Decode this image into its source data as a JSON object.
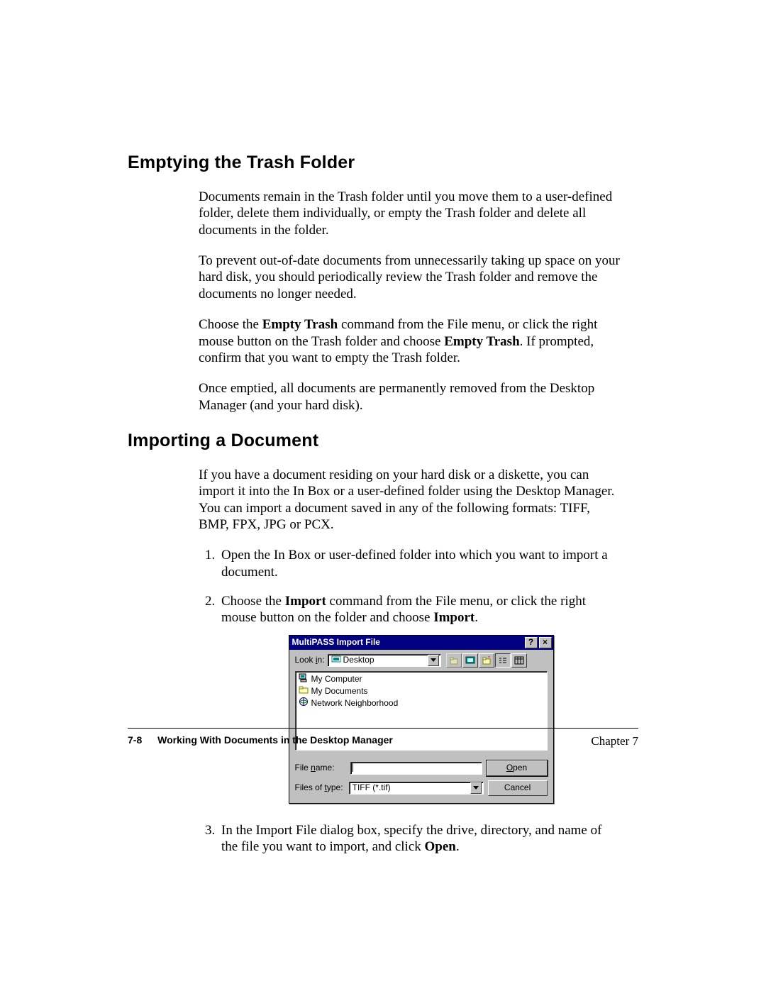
{
  "headings": {
    "h1": "Emptying the Trash Folder",
    "h2": "Importing a Document"
  },
  "paras": {
    "p1": "Documents remain in the Trash folder until you move them to a user-defined folder, delete them individually, or empty the Trash folder and delete all documents in the folder.",
    "p2": "To prevent out-of-date documents from unnecessarily taking up space on your hard disk, you should periodically review the Trash folder and remove the documents no longer needed.",
    "p3a": "Choose the ",
    "p3b": "Empty Trash",
    "p3c": " command from the File menu, or click the right mouse button on the Trash folder and choose ",
    "p3d": "Empty Trash",
    "p3e": ". If prompted, confirm that you want to empty the Trash folder.",
    "p4": "Once emptied, all documents are permanently removed from the Desktop Manager (and your hard disk).",
    "p5": "If you have a document residing on your hard disk or a diskette, you can import it into the In Box or a user-defined folder using the Desktop Manager. You can import a document saved in any of the following formats: TIFF, BMP, FPX, JPG or PCX."
  },
  "steps": {
    "s1": "Open the In Box or user-defined folder into which you want to import a document.",
    "s2a": "Choose the ",
    "s2b": "Import",
    "s2c": " command from the File menu, or click the right mouse button on the folder and choose ",
    "s2d": "Import",
    "s2e": ".",
    "s3a": "In the Import File dialog box, specify the drive, directory, and name of the file you want to import, and click ",
    "s3b": "Open",
    "s3c": "."
  },
  "dialog": {
    "title": "MultiPASS Import File",
    "help_btn": "?",
    "close_btn": "×",
    "lookin_label_pre": "Look ",
    "lookin_label_u": "i",
    "lookin_label_post": "n:",
    "lookin_value": "Desktop",
    "items": {
      "i1": "My Computer",
      "i2": "My Documents",
      "i3": "Network Neighborhood"
    },
    "filename_label_pre": "File ",
    "filename_label_u": "n",
    "filename_label_post": "ame:",
    "filename_value": "",
    "filetype_label_pre": "Files of ",
    "filetype_label_u": "t",
    "filetype_label_post": "ype:",
    "filetype_value": "TIFF (*.tif)",
    "open_u": "O",
    "open_rest": "pen",
    "cancel": "Cancel"
  },
  "footer": {
    "page": "7-8",
    "section": "Working With Documents in the Desktop Manager",
    "chapter": "Chapter 7"
  }
}
